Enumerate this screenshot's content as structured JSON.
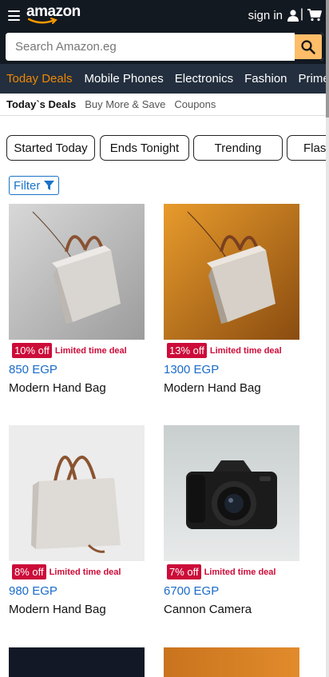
{
  "header": {
    "logo_text": "amazon",
    "signin_label": "sign in",
    "separator": "|"
  },
  "search": {
    "placeholder": "Search Amazon.eg",
    "value": ""
  },
  "categories": [
    {
      "label": "Today Deals",
      "active": true
    },
    {
      "label": "Mobile Phones"
    },
    {
      "label": "Electronics"
    },
    {
      "label": "Fashion"
    },
    {
      "label": "Prime"
    }
  ],
  "subnav": [
    {
      "label": "Today`s Deals",
      "active": true
    },
    {
      "label": "Buy More & Save"
    },
    {
      "label": "Coupons"
    }
  ],
  "pills": [
    {
      "label": "Started Today"
    },
    {
      "label": "Ends Tonight"
    },
    {
      "label": "Trending"
    },
    {
      "label": "Flash"
    }
  ],
  "filter": {
    "label": "Filter"
  },
  "products": [
    {
      "discount": "10% off",
      "deal": "Limited time deal",
      "price": "850 EGP",
      "name": "Modern Hand Bag",
      "image": "gray handbag"
    },
    {
      "discount": "13% off",
      "deal": "Limited time deal",
      "price": "1300 EGP",
      "name": "Modern Hand Bag",
      "image": "handbag on orange"
    },
    {
      "discount": "8% off",
      "deal": "Limited time deal",
      "price": "980 EGP",
      "name": "Modern Hand Bag",
      "image": "tote bag"
    },
    {
      "discount": "7% off",
      "deal": "Limited time deal",
      "price": "6700 EGP",
      "name": "Cannon Camera",
      "image": "dslr camera"
    }
  ],
  "colors": {
    "header_bg": "#131921",
    "nav_bg": "#232f3e",
    "accent_orange": "#f08804",
    "search_button": "#febd69",
    "deal_red": "#cc0c39",
    "price_blue": "#1a6bc9"
  },
  "icons": [
    "menu-icon",
    "user-icon",
    "cart-icon",
    "search-icon",
    "filter-icon"
  ]
}
